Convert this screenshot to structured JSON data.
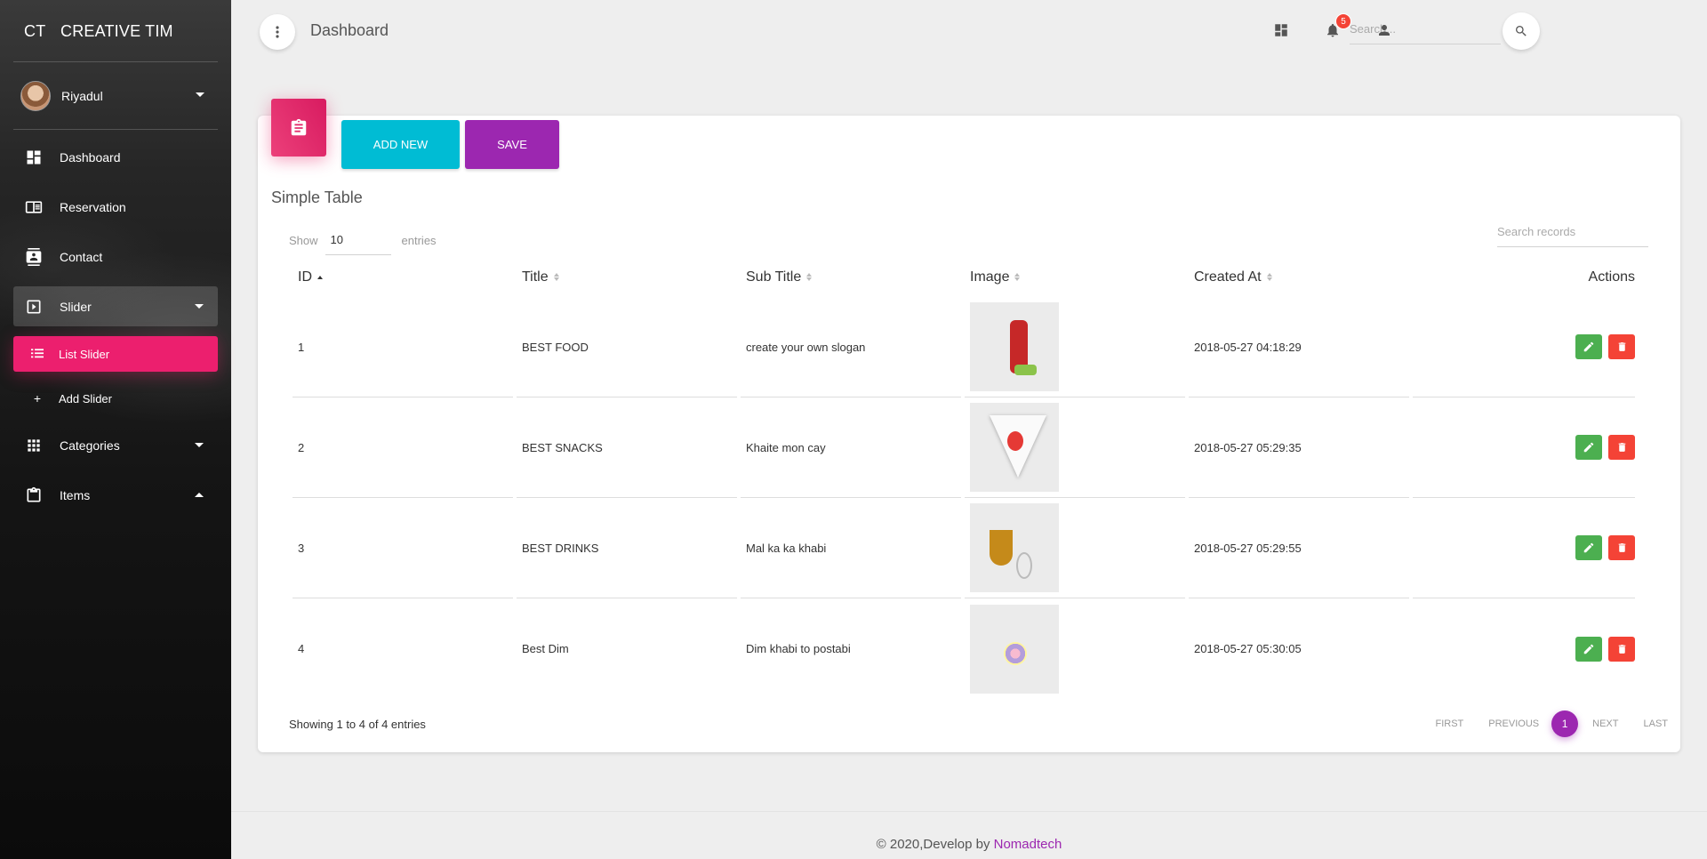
{
  "brand": {
    "mini": "CT",
    "name": "CREATIVE TIM"
  },
  "user": {
    "name": "Riyadul"
  },
  "sidebar": {
    "items": [
      {
        "label": "Dashboard",
        "icon": "dashboard-icon"
      },
      {
        "label": "Reservation",
        "icon": "reservation-icon"
      },
      {
        "label": "Contact",
        "icon": "contact-icon"
      },
      {
        "label": "Slider",
        "icon": "slider-icon"
      },
      {
        "label": "Categories",
        "icon": "apps-icon"
      },
      {
        "label": "Items",
        "icon": "clipboard-icon"
      }
    ],
    "sub_items": [
      {
        "label": "List Slider",
        "icon": "list-icon"
      },
      {
        "label": "Add Slider",
        "icon": "plus-icon"
      }
    ]
  },
  "topbar": {
    "title": "Dashboard",
    "search_placeholder": "Search...",
    "notification_count": "5"
  },
  "card": {
    "add_label": "ADD NEW",
    "save_label": "SAVE",
    "title": "Simple Table",
    "show_label": "Show",
    "entries_value": "10",
    "entries_label": "entries",
    "search_placeholder": "Search records"
  },
  "table": {
    "headers": {
      "id": "ID",
      "title": "Title",
      "subtitle": "Sub Title",
      "image": "Image",
      "created": "Created At",
      "actions": "Actions"
    },
    "rows": [
      {
        "id": "1",
        "title": "BEST FOOD",
        "subtitle": "create your own slogan",
        "created": "2018-05-27 04:18:29"
      },
      {
        "id": "2",
        "title": "BEST SNACKS",
        "subtitle": "Khaite mon cay",
        "created": "2018-05-27 05:29:35"
      },
      {
        "id": "3",
        "title": "BEST DRINKS",
        "subtitle": "Mal ka ka khabi",
        "created": "2018-05-27 05:29:55"
      },
      {
        "id": "4",
        "title": "Best Dim",
        "subtitle": "Dim khabi to postabi",
        "created": "2018-05-27 05:30:05"
      }
    ]
  },
  "pagination": {
    "info": "Showing 1 to 4 of 4 entries",
    "first": "FIRST",
    "previous": "PREVIOUS",
    "current": "1",
    "next": "NEXT",
    "last": "LAST"
  },
  "footer": {
    "copyright": "© 2020,Develop by",
    "link": "Nomadtech"
  },
  "colors": {
    "primary": "#9c27b0",
    "info": "#00bcd4",
    "rose": "#e91e63",
    "success": "#4caf50",
    "danger": "#f44336"
  }
}
